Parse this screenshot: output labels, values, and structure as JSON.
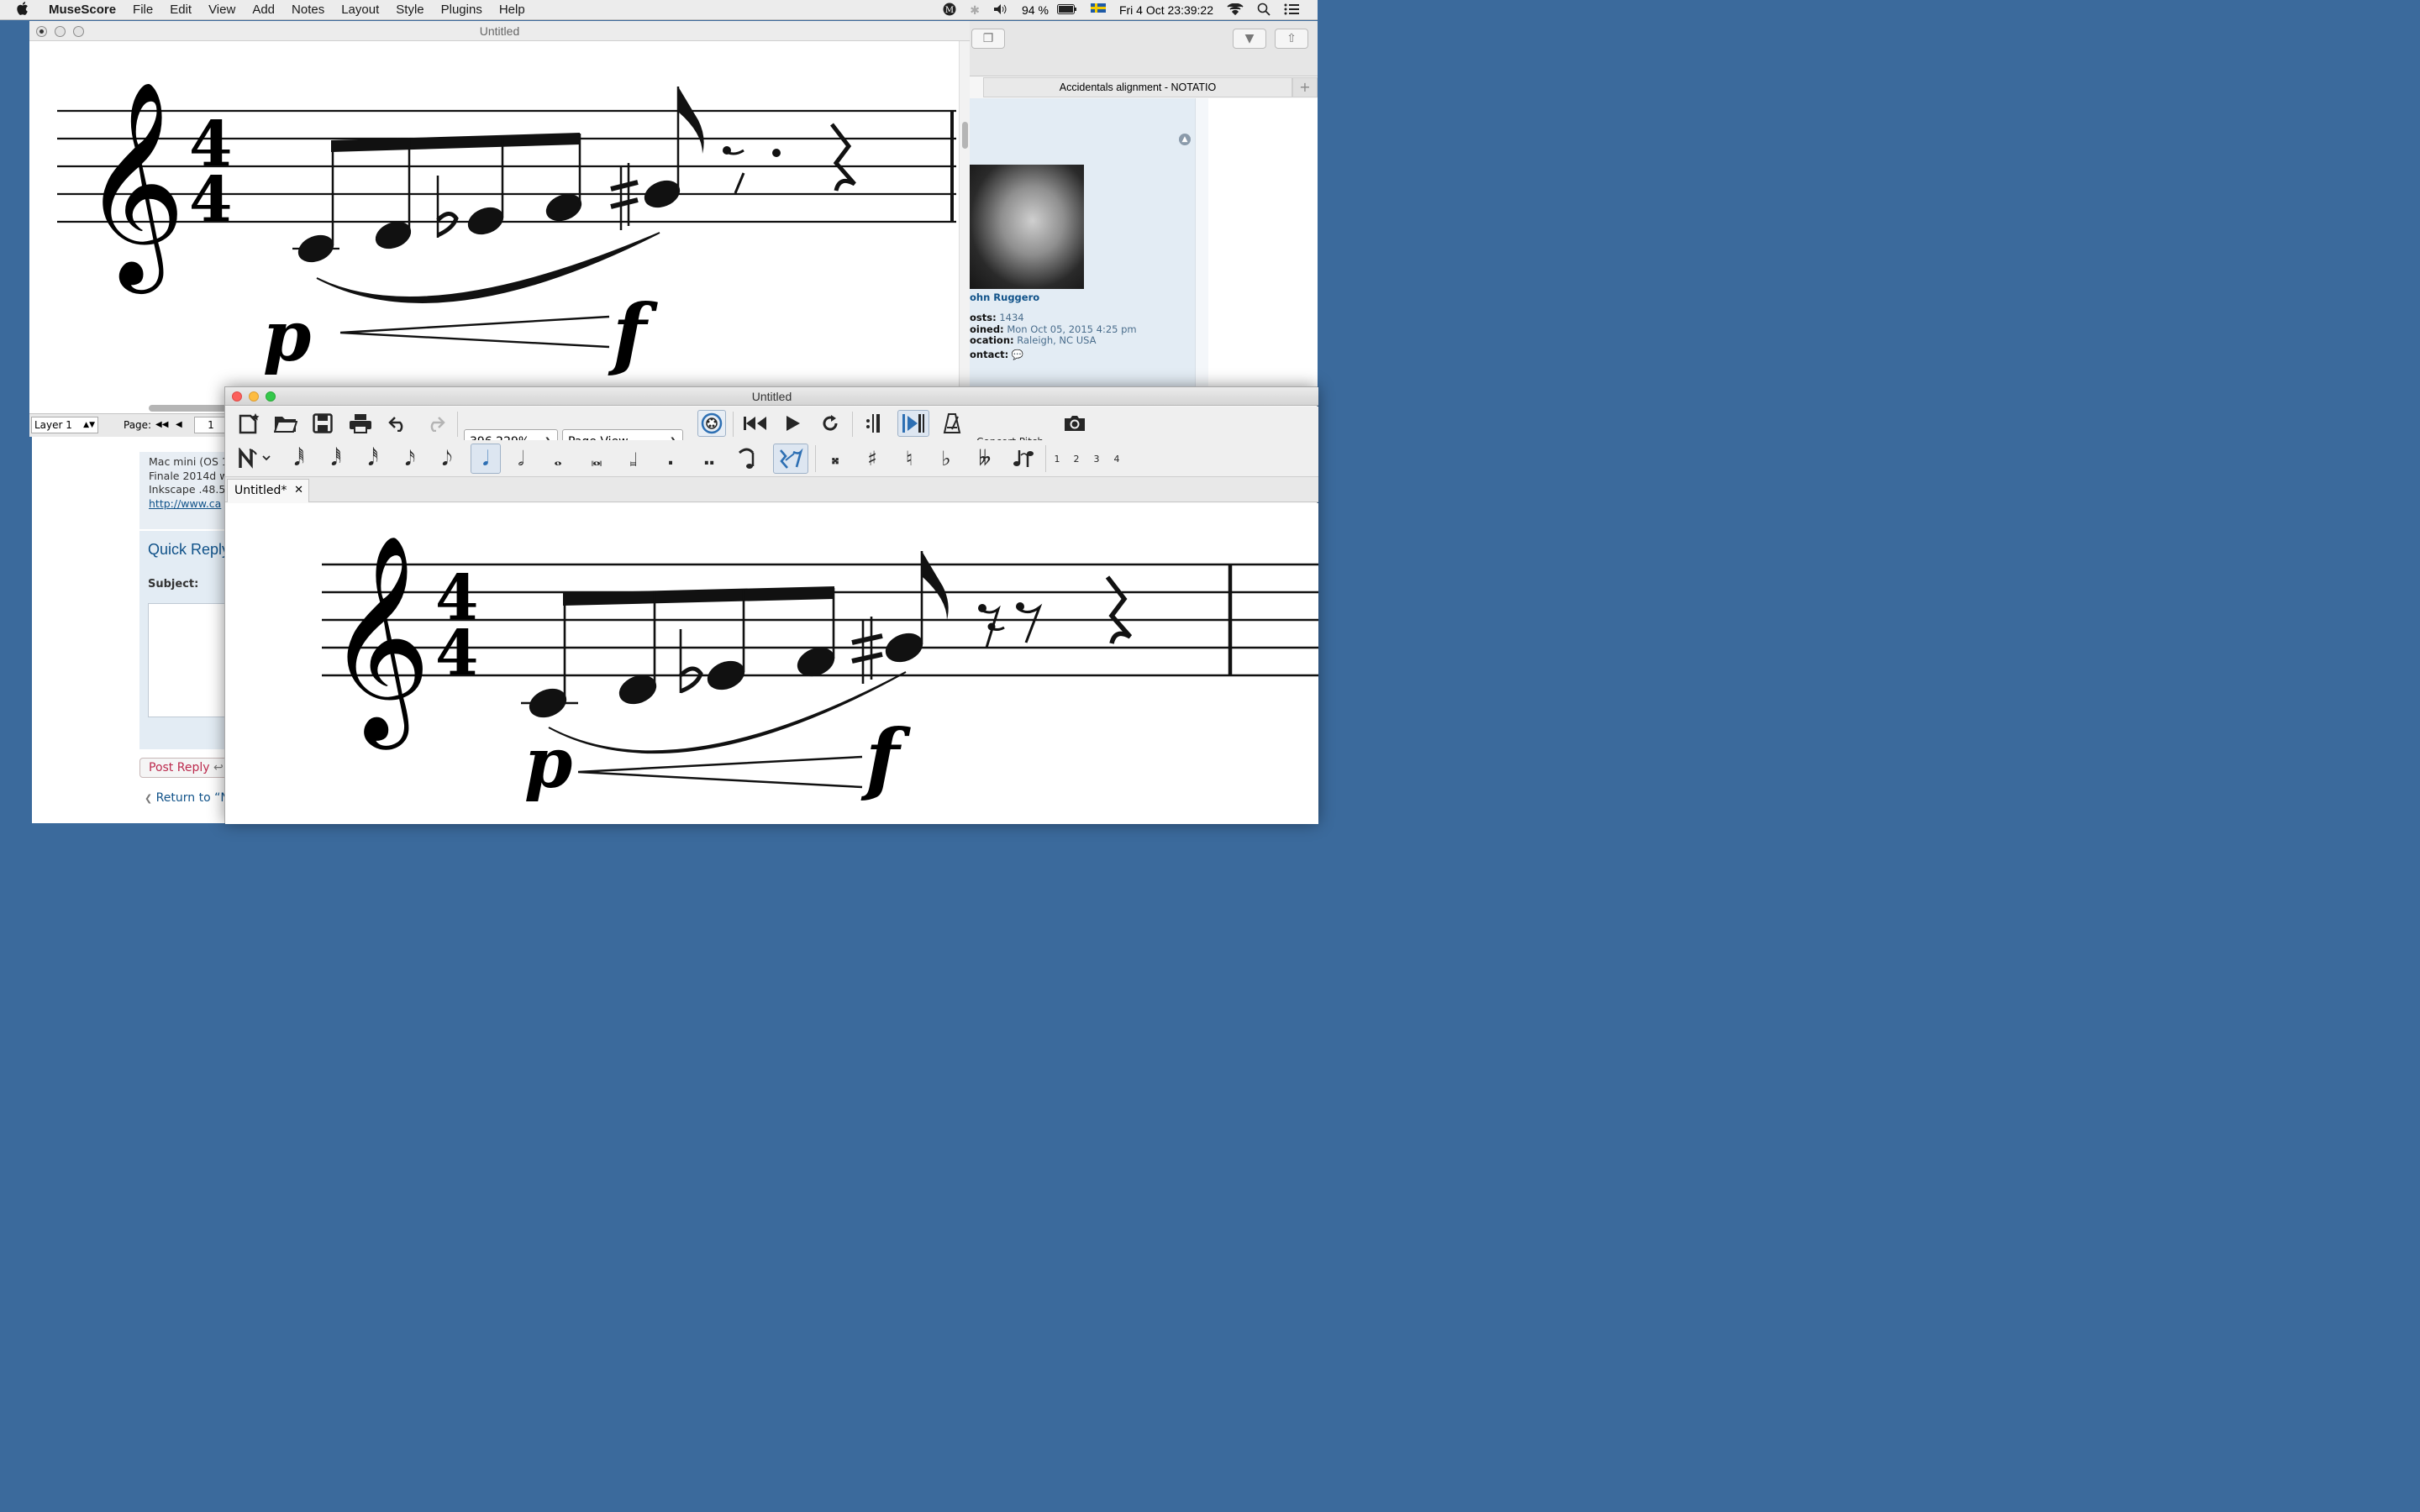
{
  "menubar": {
    "app_name": "MuseScore",
    "items": [
      "File",
      "Edit",
      "View",
      "Add",
      "Notes",
      "Layout",
      "Style",
      "Plugins",
      "Help"
    ],
    "battery": "94 %",
    "clock": "Fri 4 Oct  23:39:22"
  },
  "browser": {
    "tab_title": "Accidentals alignment - NOTATIO",
    "profile": {
      "name": "ohn Ruggero",
      "posts_label": "osts:",
      "posts_value": "1434",
      "joined_label": "oined:",
      "joined_value": "Mon Oct 05, 2015 4:25 pm",
      "location_label": "ocation:",
      "location_value": "Raleigh, NC USA",
      "contact_label": "ontact:"
    }
  },
  "forum": {
    "signature": [
      "Mac mini (OS 1",
      "Finale 2014d w",
      "Inkscape .48.5",
      "http://www.ca"
    ],
    "quick_reply": "Quick Reply",
    "subject_label": "Subject:",
    "post_reply": "Post Reply",
    "return_link": "Return to “N"
  },
  "old_window": {
    "title": "Untitled",
    "layer": "Layer 1",
    "page_label": "Page:",
    "page_value": "1"
  },
  "window": {
    "title": "Untitled",
    "zoom": "396.229%",
    "view_mode": "Page View",
    "concert_pitch": "Concert Pitch",
    "voices": [
      "1",
      "2",
      "3",
      "4"
    ],
    "doc_tab": "Untitled*",
    "dynamics": {
      "start": "p",
      "end": "f"
    }
  }
}
